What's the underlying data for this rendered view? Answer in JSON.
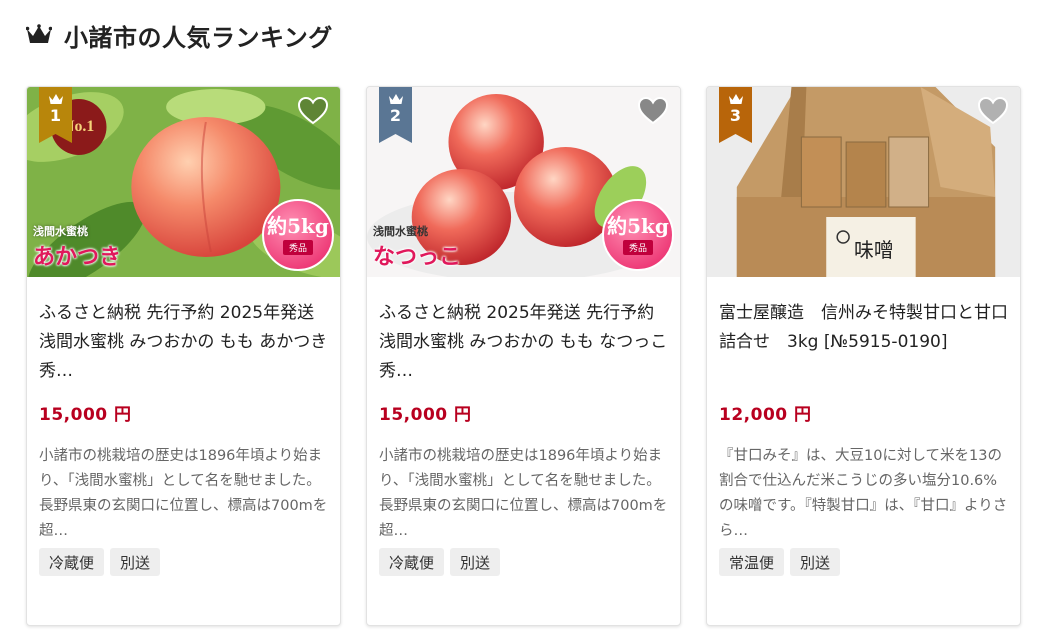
{
  "header": {
    "title": "小諸市の人気ランキング",
    "icon": "crown-icon"
  },
  "colors": {
    "gold": "#b8860b",
    "silver": "#5a7694",
    "bronze": "#b8650a",
    "price": "#b8001f"
  },
  "cards": [
    {
      "rank": "1",
      "title": "ふるさと納税 先行予約 2025年発送 浅間水蜜桃 みつおかの もも あかつき 秀…",
      "price": "15,000 円",
      "desc": "小諸市の桃栽培の歴史は1896年頃より始まり、「浅間水蜜桃」として名を馳せました。長野県東の玄関口に位置し、標高は700mを超…",
      "tags": [
        "冷蔵便",
        "別送"
      ],
      "image_label_small": "浅間水蜜桃",
      "image_label_big": "あかつき",
      "weight": "約5kg",
      "grade": "秀品"
    },
    {
      "rank": "2",
      "title": "ふるさと納税 2025年発送 先行予約 浅間水蜜桃 みつおかの もも なつっこ 秀…",
      "price": "15,000 円",
      "desc": "小諸市の桃栽培の歴史は1896年頃より始まり、「浅間水蜜桃」として名を馳せました。長野県東の玄関口に位置し、標高は700mを超…",
      "tags": [
        "冷蔵便",
        "別送"
      ],
      "image_label_small": "浅間水蜜桃",
      "image_label_big": "なつっこ",
      "weight": "約5kg",
      "grade": "秀品"
    },
    {
      "rank": "3",
      "title": "富士屋醸造　信州みそ特製甘口と甘口詰合せ　3kg [№5915-0190]",
      "price": "12,000 円",
      "desc": "『甘口みそ』は、大豆10に対して米を13の割合で仕込んだ米こうじの多い塩分10.6%の味噌です。『特製甘口』は、『甘口』よりさら…",
      "tags": [
        "常温便",
        "別送"
      ],
      "box_label": "味噌"
    }
  ]
}
